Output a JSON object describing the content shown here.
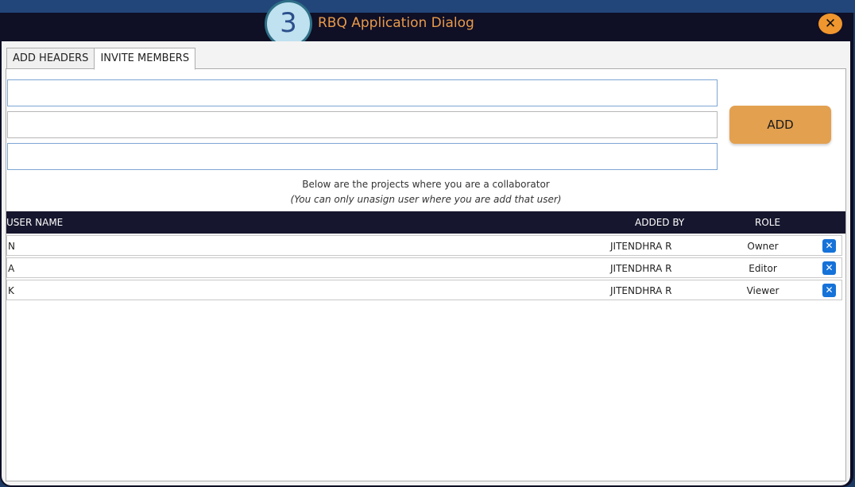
{
  "dialog": {
    "title": "RBQ Application Dialog",
    "step_badge": "3",
    "close_icon": "close-icon"
  },
  "tabs": [
    {
      "label": "ADD HEADERS",
      "active": false
    },
    {
      "label": "INVITE MEMBERS",
      "active": true
    }
  ],
  "form": {
    "field1_value": "",
    "field2_value": "",
    "field3_value": "",
    "add_label": "ADD"
  },
  "info": {
    "line1": "Below are the projects where you are a collaborator",
    "line2": "(You can only unasign user where you are add that user)"
  },
  "grid": {
    "columns": {
      "user_name": "USER NAME",
      "added_by": "ADDED BY",
      "role": "ROLE"
    },
    "rows": [
      {
        "user": "N",
        "added_by": "JITENDHRA R",
        "role": "Owner"
      },
      {
        "user": "A",
        "added_by": "JITENDHRA R",
        "role": "Editor"
      },
      {
        "user": "K",
        "added_by": "JITENDHRA R",
        "role": "Viewer"
      }
    ],
    "delete_icon": "delete-x-icon"
  },
  "colors": {
    "title_text": "#e89a4a",
    "add_button": "#e3a04f",
    "header_bg": "#16162e",
    "delete_icon": "#1572d8"
  }
}
